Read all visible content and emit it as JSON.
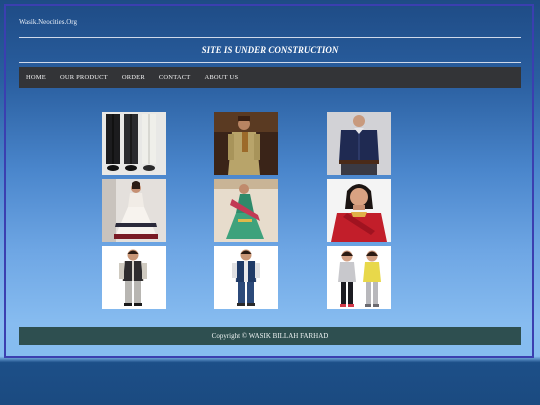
{
  "site": {
    "title": "Wasik.Neocities.Org"
  },
  "banner": {
    "text": "SITE IS UNDER CONSTRUCTION"
  },
  "nav": {
    "items": [
      "HOME",
      "OUR PRODUCT",
      "ORDER",
      "CONTACT",
      "ABOUT US"
    ]
  },
  "products": [
    {
      "subject": "trousers-photo"
    },
    {
      "subject": "kurta-photo"
    },
    {
      "subject": "navy-shirt-photo"
    },
    {
      "subject": "white-anarkali-photo"
    },
    {
      "subject": "green-salwar-photo"
    },
    {
      "subject": "red-saree-photo"
    },
    {
      "subject": "boy-vest-outfit-photo"
    },
    {
      "subject": "boy-jacket-outfit-photo"
    },
    {
      "subject": "girls-outfit-photo"
    }
  ],
  "footer": {
    "copyright": "Copyright © WASIK BILLAH FARHAD"
  }
}
